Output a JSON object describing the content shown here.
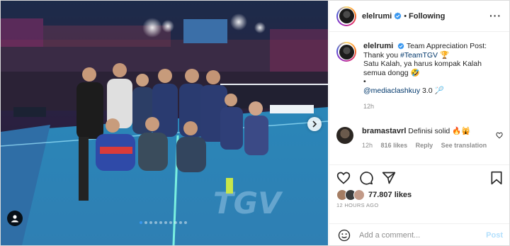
{
  "post": {
    "username": "elelrumi",
    "follow_status": "Following",
    "more_label": "···",
    "dots_total": 10,
    "dots_active": 0
  },
  "caption": {
    "username": "elelrumi",
    "line1": "Team Appreciation Post:",
    "line2": "Thank you ",
    "hashtag": "#TeamTGV",
    "trophy_icon": "🏆",
    "line3": "Satu Kalah, ya harus kompak Kalah",
    "line4": "semua dongg",
    "emoji": "🤣",
    "bullet": "•",
    "mention": "@mediaclashkuy",
    "mention_suffix": " 3.0 ",
    "racket_icon": "🏸",
    "time": "12h"
  },
  "comment": {
    "username": "bramastavrl",
    "text": "Definisi solid 🔥🙀",
    "time": "12h",
    "likes": "816 likes",
    "reply": "Reply",
    "translate": "See translation"
  },
  "footer": {
    "likes_count": "77.807 likes",
    "timestamp": "12 HOURS AGO",
    "comment_placeholder": "Add a comment...",
    "post_label": "Post"
  },
  "colors": {
    "verified": "#3897f0",
    "link": "#00376b",
    "muted": "#8e8e8e",
    "post_disabled": "#b2dffc"
  }
}
